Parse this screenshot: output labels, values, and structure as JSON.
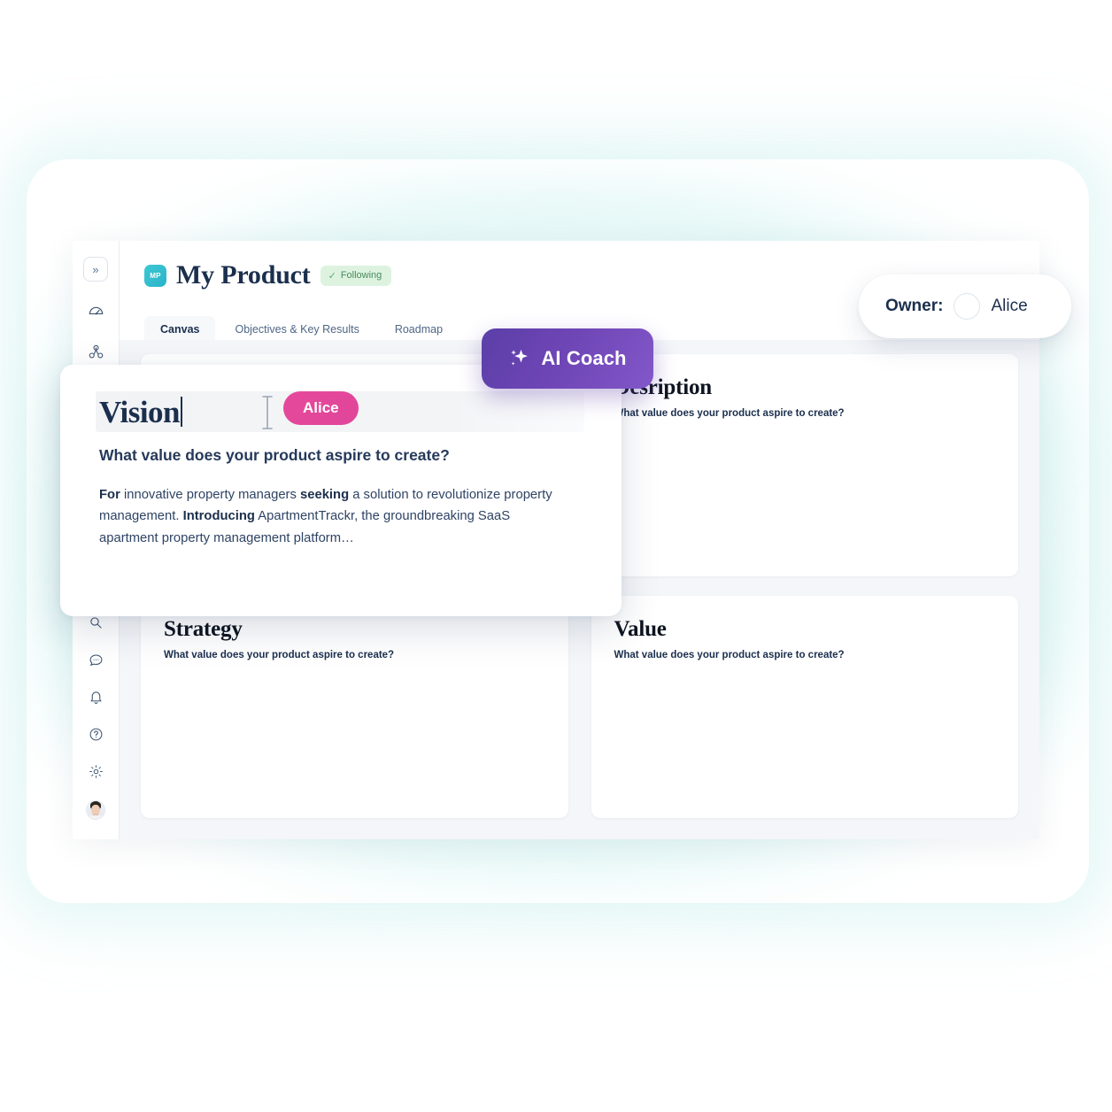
{
  "app": {
    "product_title": "My Product",
    "logo_initials": "MP",
    "following_label": "Following",
    "following_check": "check-icon",
    "brand_teal": "#29b3c9",
    "accent_purple": "#6e45b5",
    "accent_pink": "#e6499b",
    "following_green": "#ddf3e0"
  },
  "rail": {
    "collapse_icon": "double-chevron-right-icon",
    "collapse_glyph": "»",
    "items": [
      {
        "name": "dashboard-gauge-icon"
      },
      {
        "name": "hierarchy-cluster-icon"
      }
    ],
    "add_glyph": "+",
    "bottom_items": [
      {
        "name": "search-icon"
      },
      {
        "name": "comment-icon"
      },
      {
        "name": "bell-icon"
      },
      {
        "name": "help-circle-icon"
      },
      {
        "name": "settings-gear-icon"
      }
    ],
    "avatar": "user-avatar"
  },
  "tabs": [
    {
      "label": "Canvas",
      "active": true
    },
    {
      "label": "Objectives & Key Results",
      "active": false
    },
    {
      "label": "Roadmap",
      "active": false
    }
  ],
  "cards": [
    {
      "title": "Vision",
      "subtitle": "What value does your product aspire to create?"
    },
    {
      "title": "Desription",
      "subtitle": "What value does your product aspire to create?"
    },
    {
      "title": "Strategy",
      "subtitle": "What value does your product aspire to create?"
    },
    {
      "title": "Value",
      "subtitle": "What value does your product aspire to create?"
    }
  ],
  "ai_coach": {
    "label": "AI Coach",
    "icon": "sparkle-icon"
  },
  "vision_editor": {
    "title": "Vision",
    "collaborator": "Alice",
    "question": "What value does your product aspire to create?",
    "body_segments": [
      {
        "text": "For",
        "bold": true
      },
      {
        "text": " innovative property managers ",
        "bold": false
      },
      {
        "text": "seeking",
        "bold": true
      },
      {
        "text": " a solution to revolutionize property management. ",
        "bold": false
      },
      {
        "text": "Introducing",
        "bold": true
      },
      {
        "text": " ApartmentTrackr, the groundbreaking SaaS apartment property management platform…",
        "bold": false
      }
    ]
  },
  "owner_chip": {
    "label": "Owner:",
    "name": "Alice",
    "avatar": "owner-avatar"
  }
}
